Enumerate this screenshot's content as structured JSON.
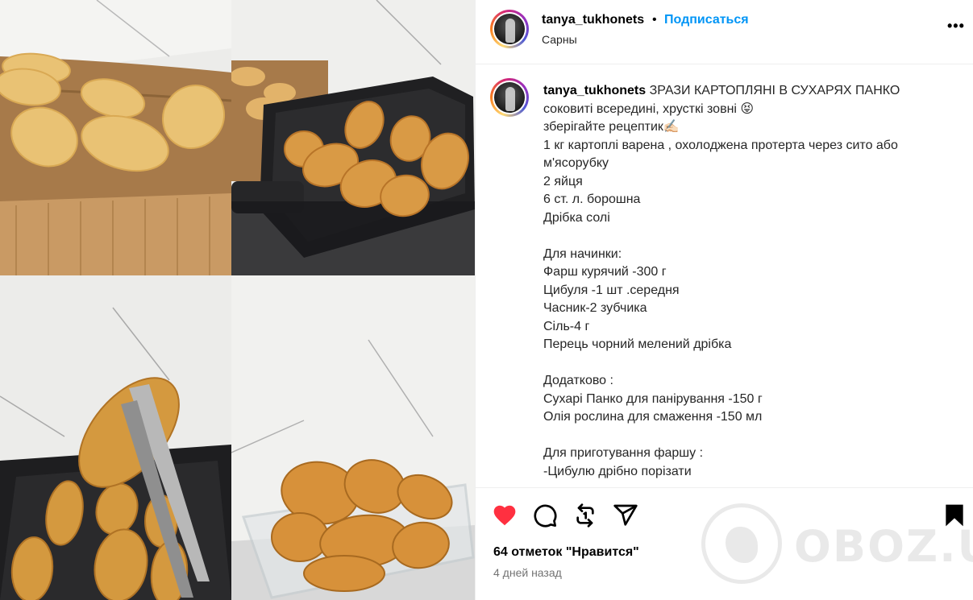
{
  "post": {
    "username": "tanya_tukhonets",
    "separator": "•",
    "follow_label": "Подписаться",
    "location": "Сарны",
    "more_label": "•••"
  },
  "caption": {
    "username": "tanya_tukhonets",
    "lines": [
      "ЗРАЗИ КАРТОПЛЯНІ В СУХАРЯХ ПАНКО",
      "соковиті всередині, хрусткі зовні 😝",
      "зберігайте рецептик✍🏻",
      "1 кг картоплі варена , охолоджена протерта через сито або м'ясорубку",
      "2 яйця",
      "6 ст. л. борошна",
      "Дрібка солі",
      "",
      "Для начинки:",
      "Фарш курячий -300 г",
      "Цибуля -1 шт .середня",
      "Часник-2 зубчика",
      "Сіль-4 г",
      "Перець чорний мелений дрібка",
      "",
      "Додатково :",
      "Сухарі Панко для панірування -150 г",
      "Олія рослина для смаження -150 мл",
      "",
      "Для приготування фаршу :",
      "-Цибулю дрібно порізати"
    ]
  },
  "actions": {
    "like_icon": "heart-icon",
    "comment_icon": "comment-icon",
    "share_icon": "repost-icon",
    "send_icon": "send-icon",
    "save_icon": "bookmark-icon",
    "like_color": "#ff3040"
  },
  "likes_text": "64 отметок \"Нравится\"",
  "time_text": "4 дней назад",
  "watermark": "OBOZ.UA"
}
